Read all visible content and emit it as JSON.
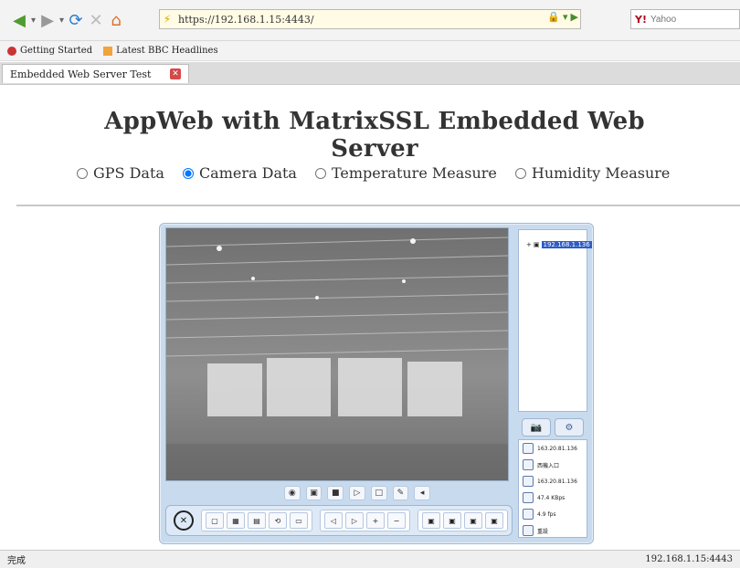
{
  "browser": {
    "url": "https://192.168.1.15:4443/",
    "search_placeholder": "Yahoo",
    "bookmarks": [
      "Getting Started",
      "Latest BBC Headlines"
    ],
    "tab_title": "Embedded Web Server Test",
    "status_left": "完成",
    "status_right": "192.168.1.15:4443"
  },
  "page": {
    "title": "AppWeb with MatrixSSL  Embedded Web Server",
    "options": [
      {
        "label": "GPS Data",
        "checked": false
      },
      {
        "label": "Camera Data",
        "checked": true
      },
      {
        "label": "Temperature Measure",
        "checked": false
      },
      {
        "label": "Humidity Measure",
        "checked": false
      }
    ]
  },
  "player": {
    "tree_node": "192.168.1.136",
    "info_rows": [
      "163.20.81.136",
      "西機入口",
      "163.20.81.136",
      "47.4 KBps",
      "4.9 fps",
      "重設"
    ]
  }
}
